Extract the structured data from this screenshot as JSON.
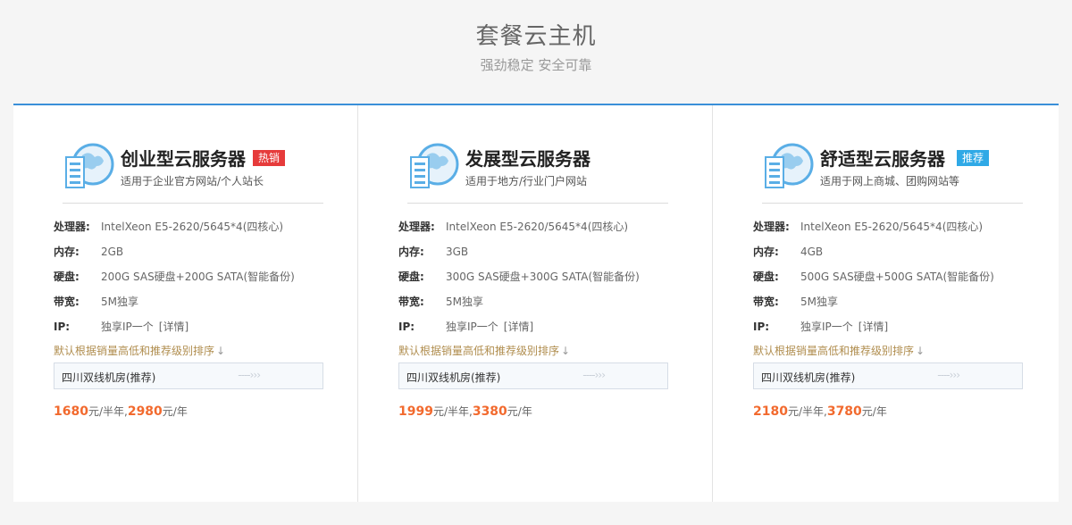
{
  "header": {
    "title": "套餐云主机",
    "subtitle": "强劲稳定 安全可靠"
  },
  "colors": {
    "accent": "#3a8fd8",
    "hot_badge": "#e63b3b",
    "recommend_badge": "#2fa9e6",
    "price": "#f26a2e",
    "sort_note": "#b08d4e"
  },
  "labels": {
    "cpu": "处理器:",
    "ram": "内存:",
    "disk": "硬盘:",
    "bandwidth": "带宽:",
    "ip": "IP:"
  },
  "cards": [
    {
      "name": "创业型云服务器",
      "badge": "热销",
      "desc": "适用于企业官方网站/个人站长",
      "cpu": "IntelXeon E5-2620/5645*4(四核心)",
      "ram": "2GB",
      "disk": "200G SAS硬盘+200G SATA(智能备份)",
      "bandwidth": "5M独享",
      "ip": "独享IP一个",
      "ip_link": "[详情]",
      "sort_note": "默认根据销量高低和推荐级别排序",
      "sort_arrow": "↓",
      "room": "四川双线机房(推荐)",
      "room_arrow": "----›››",
      "price_half": "1680",
      "unit_half": "元/半年,",
      "price_year": "2980",
      "unit_year": "元/年"
    },
    {
      "name": "发展型云服务器",
      "badge": "",
      "desc": "适用于地方/行业门户网站",
      "cpu": "IntelXeon E5-2620/5645*4(四核心)",
      "ram": "3GB",
      "disk": "300G SAS硬盘+300G SATA(智能备份)",
      "bandwidth": "5M独享",
      "ip": "独享IP一个",
      "ip_link": "[详情]",
      "sort_note": "默认根据销量高低和推荐级别排序",
      "sort_arrow": "↓",
      "room": "四川双线机房(推荐)",
      "room_arrow": "----›››",
      "price_half": "1999",
      "unit_half": "元/半年,",
      "price_year": "3380",
      "unit_year": "元/年"
    },
    {
      "name": "舒适型云服务器",
      "badge": "推荐",
      "desc": "适用于网上商城、团购网站等",
      "cpu": "IntelXeon E5-2620/5645*4(四核心)",
      "ram": "4GB",
      "disk": "500G SAS硬盘+500G SATA(智能备份)",
      "bandwidth": "5M独享",
      "ip": "独享IP一个",
      "ip_link": "[详情]",
      "sort_note": "默认根据销量高低和推荐级别排序",
      "sort_arrow": "↓",
      "room": "四川双线机房(推荐)",
      "room_arrow": "----›››",
      "price_half": "2180",
      "unit_half": "元/半年,",
      "price_year": "3780",
      "unit_year": "元/年"
    }
  ]
}
